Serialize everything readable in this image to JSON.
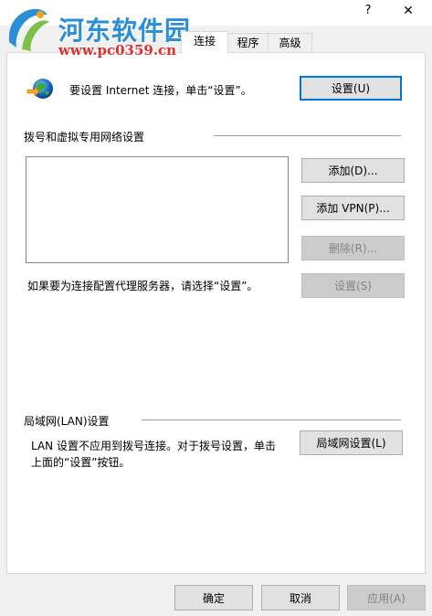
{
  "window": {
    "title_fragment": "…",
    "help_label": "?",
    "close_label": "✕"
  },
  "watermark": {
    "title": "河东软件园",
    "url": "www.pc0359.cn"
  },
  "tabs": [
    {
      "label": "连接",
      "active": true
    },
    {
      "label": "程序",
      "active": false
    },
    {
      "label": "高级",
      "active": false
    }
  ],
  "connection": {
    "setup_text": "要设置 Internet 连接，单击“设置”。",
    "setup_button": "设置(U)",
    "dialup_header": "拨号和虚拟专用网络设置",
    "add_button": "添加(D)...",
    "add_vpn_button": "添加 VPN(P)...",
    "remove_button": "删除(R)...",
    "proxy_text": "如果要为连接配置代理服务器，请选择“设置”。",
    "settings_button": "设置(S)",
    "lan_header": "局域网(LAN)设置",
    "lan_text_line1": "LAN 设置不应用到拨号连接。对于拨号设置，单击",
    "lan_text_line2": "上面的“设置”按钮。",
    "lan_button": "局域网设置(L)"
  },
  "footer": {
    "ok_button": "确定",
    "cancel_button": "取消",
    "apply_button": "应用(A)"
  },
  "colors": {
    "accent": "#0078d7",
    "watermark_blue": "#2a8fd6",
    "watermark_red": "#d9322e"
  }
}
